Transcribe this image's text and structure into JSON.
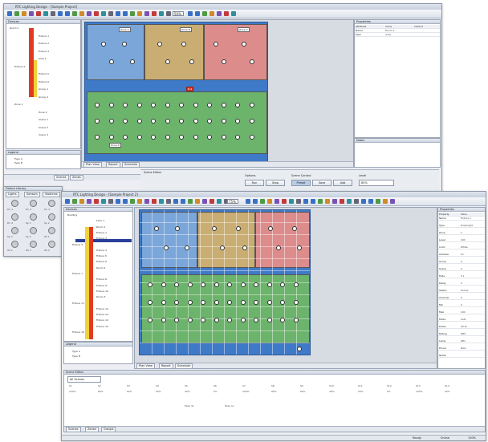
{
  "window1": {
    "title": "RTC Lighting Design - [Sample Project]",
    "zoom": "50%",
    "tree_header": "Devices",
    "tree_items": [
      "Room 1",
      "Fixture 1",
      "Fixture 2",
      "Fixture 3",
      "Area 1",
      "Fixture 4",
      "Fixture 5",
      "Fixture 6",
      "Group 1",
      "Group 2",
      "Zone 1",
      "Zone 2",
      "Scene 1",
      "Scene 2",
      "Scene 3",
      "Scene 4"
    ],
    "legend_header": "Legend",
    "legend_items": [
      "Type A",
      "Type B"
    ],
    "properties_header": "Properties",
    "prop_cols": [
      "Attribute",
      "Value",
      "Default"
    ],
    "props": [
      [
        "Name",
        "Room 1"
      ],
      [
        "Type",
        "Area"
      ]
    ],
    "sub_panel_header": "Notes",
    "view_tabs": [
      "Plan View",
      "Report",
      "Schedule"
    ],
    "zone_labels": [
      "Zone A",
      "Zone B",
      "Zone C",
      "Zone D"
    ],
    "selected_label": "D 4",
    "bottom_header": "Scene Editor",
    "bottom_tabs": [
      "Scenes",
      "Zones"
    ],
    "group_left_label": "Options",
    "group_left_buttons": [
      "Run",
      "Stop"
    ],
    "group_mid_label": "Scene Control",
    "group_mid_buttons": [
      "Preset",
      "Save",
      "Add"
    ],
    "group_right_label": "Level",
    "group_right_value": "80%"
  },
  "window2": {
    "title": "RTC Lighting Design - [Sample Project 2]",
    "zoom": "75%",
    "tree_header": "Devices",
    "tree_items": [
      "Building",
      "Floor 1",
      "Room 1",
      "Fixture 1",
      "Fixture 2",
      "Fixture 3",
      "Fixture 4",
      "Fixture 5",
      "Fixture 6",
      "Room 2",
      "Fixture 7",
      "Fixture 8",
      "Fixture 9",
      "Fixture 10",
      "Room 3",
      "Fixture 11",
      "Fixture 12",
      "Fixture 13",
      "Fixture 14",
      "Fixture 15",
      "Fixture 16",
      "Fixture 17"
    ],
    "legend_header": "Legend",
    "legend_items": [
      "Type A",
      "Type B"
    ],
    "properties_header": "Properties",
    "prop_cols": [
      "Property",
      "Value"
    ],
    "props": [
      [
        "Name",
        "Fixture 1"
      ],
      [
        "Type",
        "Downlight"
      ],
      [
        "Zone",
        "1"
      ],
      [
        "Level",
        "100"
      ],
      [
        "Color",
        "White"
      ],
      [
        "Address",
        "12"
      ],
      [
        "Group",
        "A"
      ],
      [
        "Scene",
        "2"
      ],
      [
        "Fade",
        "3 s"
      ],
      [
        "Delay",
        "0"
      ],
      [
        "Status",
        "Online"
      ],
      [
        "Channel",
        "5"
      ],
      [
        "Min",
        "0"
      ],
      [
        "Max",
        "100"
      ],
      [
        "Mode",
        "Auto"
      ],
      [
        "Power",
        "40 W"
      ],
      [
        "Rating",
        "IP20"
      ],
      [
        "Lamp",
        "LED"
      ],
      [
        "Driver",
        "DALI"
      ],
      [
        "Notes",
        ""
      ]
    ],
    "view_tabs": [
      "Plan View",
      "Report",
      "Schedule"
    ],
    "bottom_header": "Scene Editor",
    "bottom_filter": "All Scenes",
    "scene_cols": [
      "S1",
      "S2",
      "S3",
      "S4",
      "S5",
      "S6",
      "S7",
      "S8",
      "S9",
      "S10",
      "S11",
      "S12",
      "S13",
      "S14"
    ],
    "scene_values": [
      "100%",
      "80%",
      "60%",
      "40%",
      "20%",
      "0%",
      "100%",
      "80%",
      "60%",
      "40%",
      "20%",
      "0%",
      "100%",
      "50%"
    ],
    "scene_rows2": [
      "Fade 3s",
      "Fade 1s"
    ],
    "bottom_tabs": [
      "Scenes",
      "Zones",
      "Groups"
    ],
    "status_items": [
      "Ready",
      "Online",
      "100%"
    ]
  },
  "side_palette": {
    "header": "Fixture Library",
    "tabs": [
      "Lights",
      "Sensors",
      "Switches"
    ],
    "items": [
      "Dn 1",
      "Dn 2",
      "Dn 3",
      "Dn 4",
      "Sp 1",
      "Sp 2",
      "Sp 3",
      "Sp 4",
      "Wl 1",
      "Wl 2",
      "Wl 3",
      "Wl 4"
    ]
  },
  "colors": {
    "field_blue": "#3f7ac8",
    "zone_blue": "#7ba6d9",
    "zone_tan": "#c9ad73",
    "zone_pink": "#dd8c8c",
    "zone_green": "#6cb36b",
    "tree_red": "#e23a1f",
    "tree_yellow": "#f0d23a"
  }
}
